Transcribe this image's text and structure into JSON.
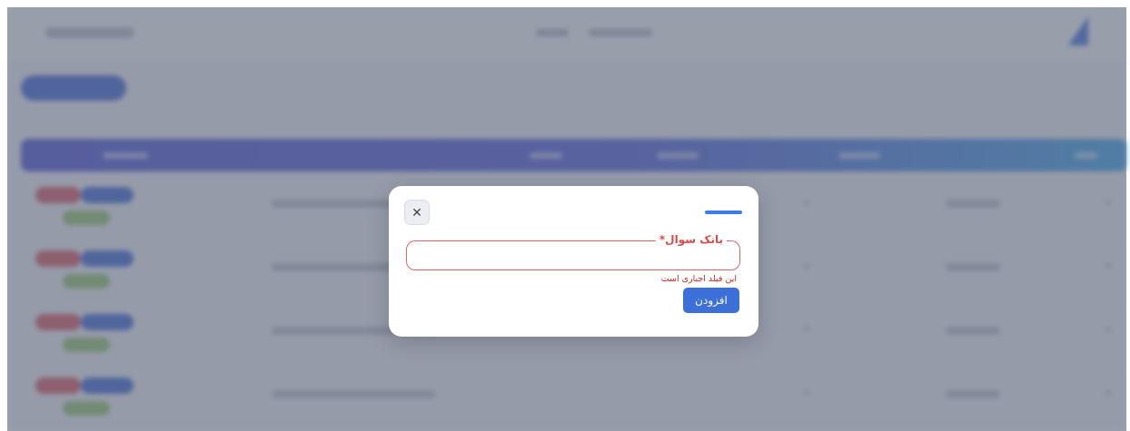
{
  "dialog": {
    "close_glyph": "✕",
    "field": {
      "label": "بانک سوال*",
      "value": "",
      "placeholder": ""
    },
    "error": "این فیلد اجباری است",
    "submit_label": "افزودن"
  },
  "colors": {
    "accent": "#3d6fd9",
    "error": "#d94a4a",
    "overlay": "#60687a"
  }
}
